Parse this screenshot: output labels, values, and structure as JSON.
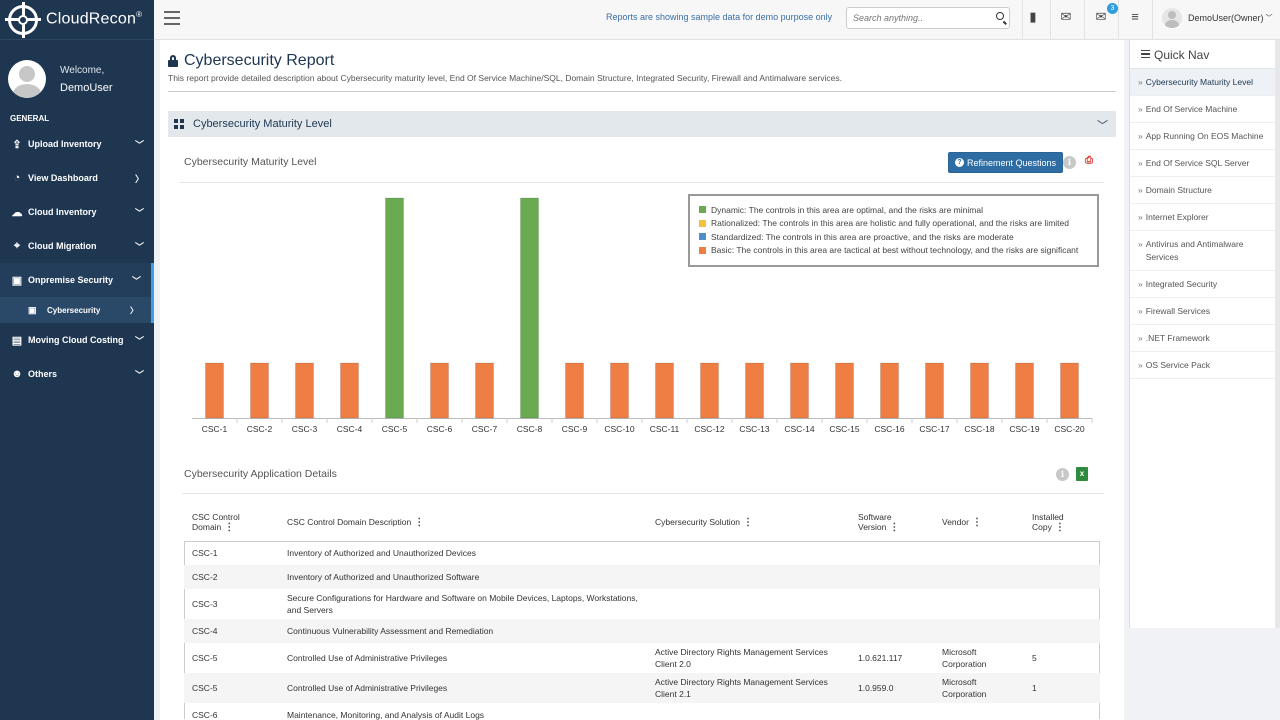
{
  "brand": {
    "name": "CloudRecon",
    "mark": "®"
  },
  "profile": {
    "welcome": "Welcome,",
    "username": "DemoUser"
  },
  "sidebar": {
    "section": "GENERAL",
    "items": [
      {
        "label": "Upload Inventory",
        "icon": "upload-icon"
      },
      {
        "label": "View Dashboard",
        "icon": "dashboard-icon"
      },
      {
        "label": "Cloud Inventory",
        "icon": "cloud-icon"
      },
      {
        "label": "Cloud Migration",
        "icon": "crosshair-icon"
      },
      {
        "label": "Onpremise Security",
        "icon": "lock-icon"
      },
      {
        "label": "Cybersecurity",
        "icon": "lock-icon"
      },
      {
        "label": "Moving Cloud Costing",
        "icon": "money-icon"
      },
      {
        "label": "Others",
        "icon": "users-icon"
      }
    ]
  },
  "topbar": {
    "demo_note": "Reports are showing sample data for demo purpose only",
    "search_placeholder": "Search anything..",
    "notification_count": "3",
    "user_label": "DemoUser(Owner)"
  },
  "page": {
    "title": "Cybersecurity Report",
    "subtitle": "This report provide detailed description about Cybersecurity maturity level, End Of Service Machine/SQL, Domain Structure, Integrated Security, Firewall and Antimalware services.",
    "section_title": "Cybersecurity Maturity Level",
    "chart_panel_title": "Cybersecurity Maturity Level",
    "refinement_button": "Refinement Questions",
    "details_title": "Cybersecurity Application Details"
  },
  "colors": {
    "dynamic": "#6aab52",
    "rationalized": "#f0c33a",
    "standardized": "#4f8fc9",
    "basic": "#ef7e45",
    "sidebar_bg": "#1e3650",
    "accent": "#2e6da4"
  },
  "legend": [
    {
      "label": "Dynamic: The controls in this area are optimal, and the risks are minimal",
      "color": "#6aab52"
    },
    {
      "label": "Rationalized: The controls in this area are holistic and fully operational, and the risks are limited",
      "color": "#f0c33a"
    },
    {
      "label": "Standardized: The controls in this area are proactive, and the risks are moderate",
      "color": "#4f8fc9"
    },
    {
      "label": "Basic: The controls in this area are tactical at best without technology, and the risks are significant",
      "color": "#ef7e45"
    }
  ],
  "chart_data": {
    "type": "bar",
    "title": "Cybersecurity Maturity Level",
    "categories": [
      "CSC-1",
      "CSC-2",
      "CSC-3",
      "CSC-4",
      "CSC-5",
      "CSC-6",
      "CSC-7",
      "CSC-8",
      "CSC-9",
      "CSC-10",
      "CSC-11",
      "CSC-12",
      "CSC-13",
      "CSC-14",
      "CSC-15",
      "CSC-16",
      "CSC-17",
      "CSC-18",
      "CSC-19",
      "CSC-20"
    ],
    "values": [
      1,
      1,
      1,
      1,
      4,
      1,
      1,
      4,
      1,
      1,
      1,
      1,
      1,
      1,
      1,
      1,
      1,
      1,
      1,
      1
    ],
    "levels": [
      "Basic",
      "Basic",
      "Basic",
      "Basic",
      "Dynamic",
      "Basic",
      "Basic",
      "Dynamic",
      "Basic",
      "Basic",
      "Basic",
      "Basic",
      "Basic",
      "Basic",
      "Basic",
      "Basic",
      "Basic",
      "Basic",
      "Basic",
      "Basic"
    ],
    "ylim": [
      0,
      4
    ],
    "grid": false,
    "legend_position": "top-right"
  },
  "table": {
    "columns": [
      {
        "label": "CSC Control Domain"
      },
      {
        "label": "CSC Control Domain Description"
      },
      {
        "label": "Cybersecurity Solution"
      },
      {
        "label": "Software Version"
      },
      {
        "label": "Vendor"
      },
      {
        "label": "Installed Copy"
      }
    ],
    "rows": [
      [
        "CSC-1",
        "Inventory of Authorized and Unauthorized Devices",
        "",
        "",
        "",
        ""
      ],
      [
        "CSC-2",
        "Inventory of Authorized and Unauthorized Software",
        "",
        "",
        "",
        ""
      ],
      [
        "CSC-3",
        "Secure Configurations for Hardware and Software on Mobile Devices, Laptops, Workstations, and Servers",
        "",
        "",
        "",
        ""
      ],
      [
        "CSC-4",
        "Continuous Vulnerability Assessment and Remediation",
        "",
        "",
        "",
        ""
      ],
      [
        "CSC-5",
        "Controlled Use of Administrative Privileges",
        "Active Directory Rights Management Services Client 2.0",
        "1.0.621.117",
        "Microsoft Corporation",
        "5"
      ],
      [
        "CSC-5",
        "Controlled Use of Administrative Privileges",
        "Active Directory Rights Management Services Client 2.1",
        "1.0.959.0",
        "Microsoft Corporation",
        "1"
      ],
      [
        "CSC-6",
        "Maintenance, Monitoring, and Analysis of Audit Logs",
        "",
        "",
        "",
        ""
      ]
    ]
  },
  "quicknav": {
    "title": "Quick Nav",
    "items": [
      "Cybersecurity Maturity Level",
      "End Of Service Machine",
      "App Running On EOS Machine",
      "End Of Service SQL Server",
      "Domain Structure",
      "Internet Explorer",
      "Antivirus and Antimalware Services",
      "Integrated Security",
      "Firewall Services",
      ".NET Framework",
      "OS Service Pack"
    ]
  }
}
